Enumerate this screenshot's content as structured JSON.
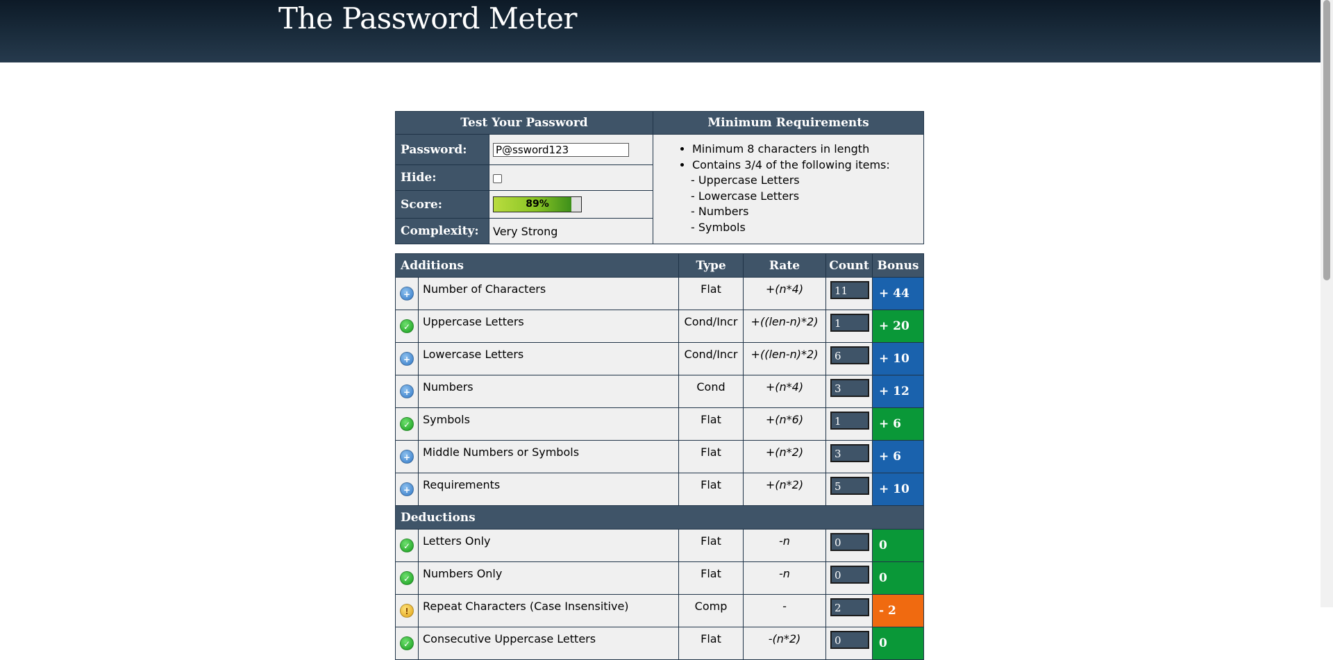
{
  "header": {
    "title": "The Password Meter"
  },
  "test_panel": {
    "heading": "Test Your Password",
    "password_label": "Password:",
    "password_value": "P@ssword123",
    "hide_label": "Hide:",
    "score_label": "Score:",
    "score_text": "89%",
    "score_percent": 89,
    "complexity_label": "Complexity:",
    "complexity_value": "Very Strong"
  },
  "requirements": {
    "heading": "Minimum Requirements",
    "items": [
      "Minimum 8 characters in length",
      "Contains 3/4 of the following items:"
    ],
    "sub_items": [
      "- Uppercase Letters",
      "- Lowercase Letters",
      "- Numbers",
      "- Symbols"
    ]
  },
  "columns": {
    "additions": "Additions",
    "type": "Type",
    "rate": "Rate",
    "count": "Count",
    "bonus": "Bonus"
  },
  "additions": [
    {
      "icon": "plus",
      "name": "Number of Characters",
      "type": "Flat",
      "rate": "+(n*4)",
      "count": "11",
      "bonus": "+ 44",
      "color": "blue"
    },
    {
      "icon": "check",
      "name": "Uppercase Letters",
      "type": "Cond/Incr",
      "rate": "+((len-n)*2)",
      "count": "1",
      "bonus": "+ 20",
      "color": "green"
    },
    {
      "icon": "plus",
      "name": "Lowercase Letters",
      "type": "Cond/Incr",
      "rate": "+((len-n)*2)",
      "count": "6",
      "bonus": "+ 10",
      "color": "blue"
    },
    {
      "icon": "plus",
      "name": "Numbers",
      "type": "Cond",
      "rate": "+(n*4)",
      "count": "3",
      "bonus": "+ 12",
      "color": "blue"
    },
    {
      "icon": "check",
      "name": "Symbols",
      "type": "Flat",
      "rate": "+(n*6)",
      "count": "1",
      "bonus": "+ 6",
      "color": "green"
    },
    {
      "icon": "plus",
      "name": "Middle Numbers or Symbols",
      "type": "Flat",
      "rate": "+(n*2)",
      "count": "3",
      "bonus": "+ 6",
      "color": "blue"
    },
    {
      "icon": "plus",
      "name": "Requirements",
      "type": "Flat",
      "rate": "+(n*2)",
      "count": "5",
      "bonus": "+ 10",
      "color": "blue"
    }
  ],
  "deductions_label": "Deductions",
  "deductions": [
    {
      "icon": "check",
      "name": "Letters Only",
      "type": "Flat",
      "rate": "-n",
      "count": "0",
      "bonus": "0",
      "color": "green"
    },
    {
      "icon": "check",
      "name": "Numbers Only",
      "type": "Flat",
      "rate": "-n",
      "count": "0",
      "bonus": "0",
      "color": "green"
    },
    {
      "icon": "warn",
      "name": "Repeat Characters (Case Insensitive)",
      "type": "Comp",
      "rate": "-",
      "count": "2",
      "bonus": "- 2",
      "color": "orange"
    },
    {
      "icon": "check",
      "name": "Consecutive Uppercase Letters",
      "type": "Flat",
      "rate": "-(n*2)",
      "count": "0",
      "bonus": "0",
      "color": "green"
    }
  ],
  "icons": {
    "plus": "plus-circle-icon",
    "check": "check-circle-icon",
    "warn": "warning-circle-icon"
  },
  "colors": {
    "blue": "#1a62ad",
    "green": "#0a9838",
    "orange": "#f06a10",
    "header": "#1a2c3c"
  }
}
